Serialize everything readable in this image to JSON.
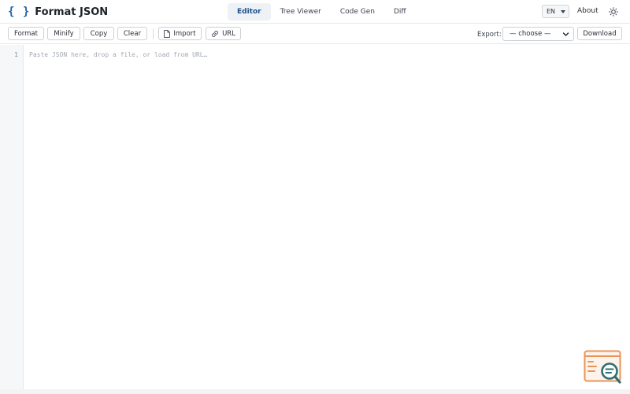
{
  "header": {
    "brand_icon": "{ }",
    "title": "Format JSON",
    "tabs": [
      {
        "label": "Editor",
        "active": true
      },
      {
        "label": "Tree Viewer",
        "active": false
      },
      {
        "label": "Code Gen",
        "active": false
      },
      {
        "label": "Diff",
        "active": false
      }
    ],
    "language": "EN",
    "about_label": "About",
    "theme_icon": "sun-icon"
  },
  "toolbar": {
    "format_label": "Format",
    "minify_label": "Minify",
    "copy_label": "Copy",
    "clear_label": "Clear",
    "import_label": "Import",
    "import_icon": "file-icon",
    "url_label": "URL",
    "url_icon": "link-icon",
    "export_label": "Export:",
    "export_selected": "— choose —",
    "download_label": "Download"
  },
  "editor": {
    "line_number": "1",
    "placeholder": "Paste JSON here, drop a file, or load from URL…"
  },
  "colors": {
    "accent": "#2563a6",
    "badge_orange": "#e8955a",
    "badge_teal": "#2f6f73"
  }
}
